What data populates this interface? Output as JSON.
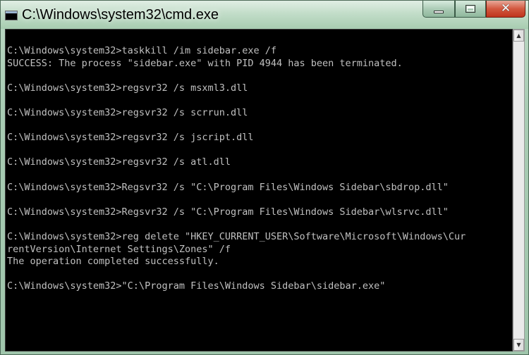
{
  "window": {
    "title": "C:\\Windows\\system32\\cmd.exe",
    "controls": {
      "minimize": "minimize",
      "maximize": "maximize",
      "close": "✕"
    }
  },
  "console": {
    "lines": [
      "C:\\Windows\\system32>taskkill /im sidebar.exe /f",
      "SUCCESS: The process \"sidebar.exe\" with PID 4944 has been terminated.",
      "",
      "C:\\Windows\\system32>regsvr32 /s msxml3.dll",
      "",
      "C:\\Windows\\system32>regsvr32 /s scrrun.dll",
      "",
      "C:\\Windows\\system32>regsvr32 /s jscript.dll",
      "",
      "C:\\Windows\\system32>regsvr32 /s atl.dll",
      "",
      "C:\\Windows\\system32>Regsvr32 /s \"C:\\Program Files\\Windows Sidebar\\sbdrop.dll\"",
      "",
      "C:\\Windows\\system32>Regsvr32 /s \"C:\\Program Files\\Windows Sidebar\\wlsrvc.dll\"",
      "",
      "C:\\Windows\\system32>reg delete \"HKEY_CURRENT_USER\\Software\\Microsoft\\Windows\\Cur",
      "rentVersion\\Internet Settings\\Zones\" /f",
      "The operation completed successfully.",
      "",
      "C:\\Windows\\system32>\"C:\\Program Files\\Windows Sidebar\\sidebar.exe\""
    ],
    "text_color": "#c0c0c0",
    "background_color": "#000000"
  },
  "icons": {
    "app": "cmd-icon",
    "scroll_up": "▲",
    "scroll_down": "▼"
  }
}
